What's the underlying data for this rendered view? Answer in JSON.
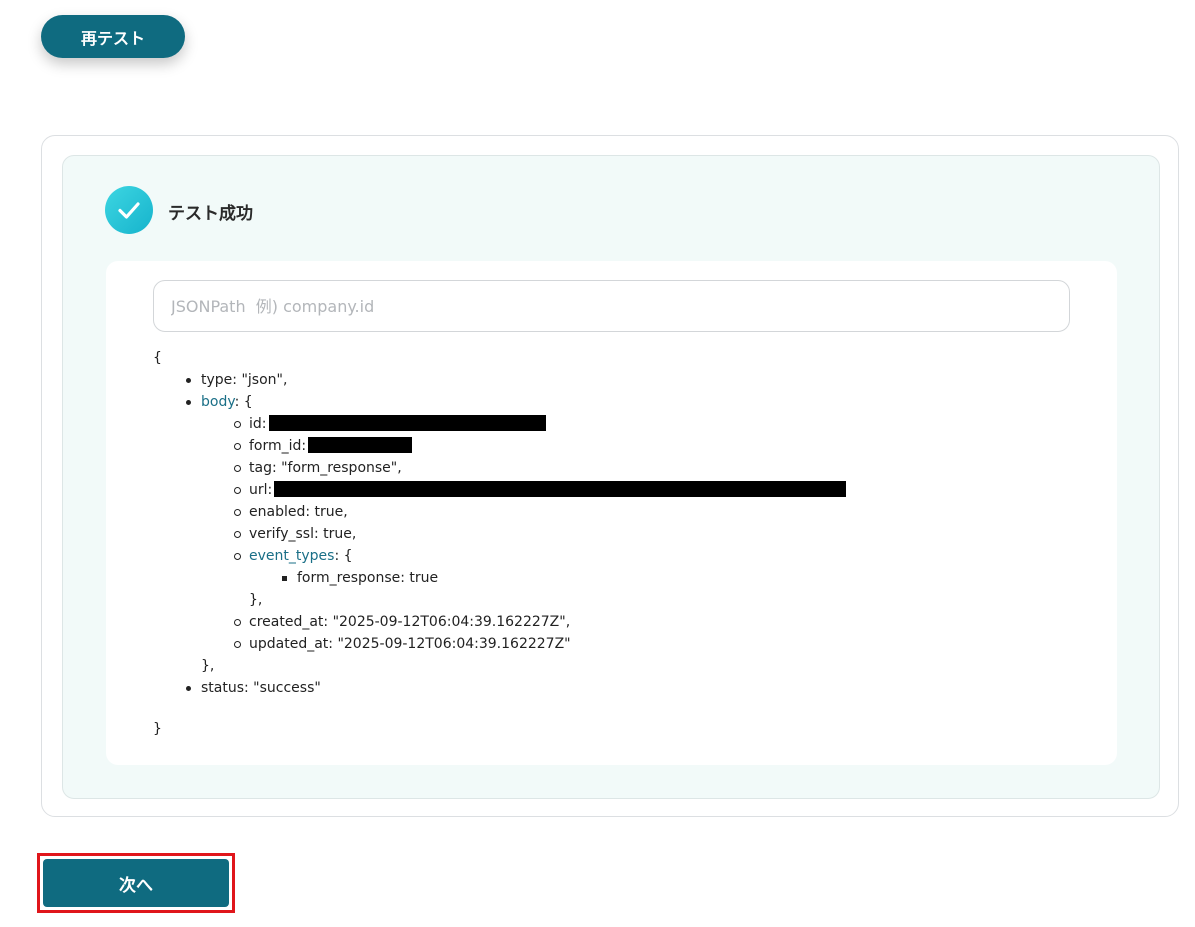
{
  "retest_button": {
    "label": "再テスト"
  },
  "result": {
    "status_icon": "check-icon",
    "title": "テスト成功"
  },
  "jsonpath": {
    "placeholder": "JSONPath  例) company.id",
    "value": ""
  },
  "json_output": {
    "open_brace": "{",
    "type_line": "type: \"json\",",
    "body_key": "body",
    "body_open": ": {",
    "id_label": "id:",
    "form_id_label": "form_id:",
    "tag_line": "tag: \"form_response\",",
    "url_label": "url:",
    "enabled_line": "enabled: true,",
    "verify_ssl_line": "verify_ssl: true,",
    "event_types_key": "event_types",
    "event_types_open": ": {",
    "form_response_line": "form_response: true",
    "event_types_close": "},",
    "created_at_line": "created_at: \"2025-09-12T06:04:39.162227Z\",",
    "updated_at_line": "updated_at: \"2025-09-12T06:04:39.162227Z\"",
    "body_close": "},",
    "status_line": "status: \"success\"",
    "close_brace": "}"
  },
  "next_button": {
    "label": "次へ"
  },
  "colors": {
    "primary": "#0f6b80",
    "success_icon": "#16b3cc",
    "link_key": "#1a6f87",
    "highlight_border": "#e0161b"
  }
}
